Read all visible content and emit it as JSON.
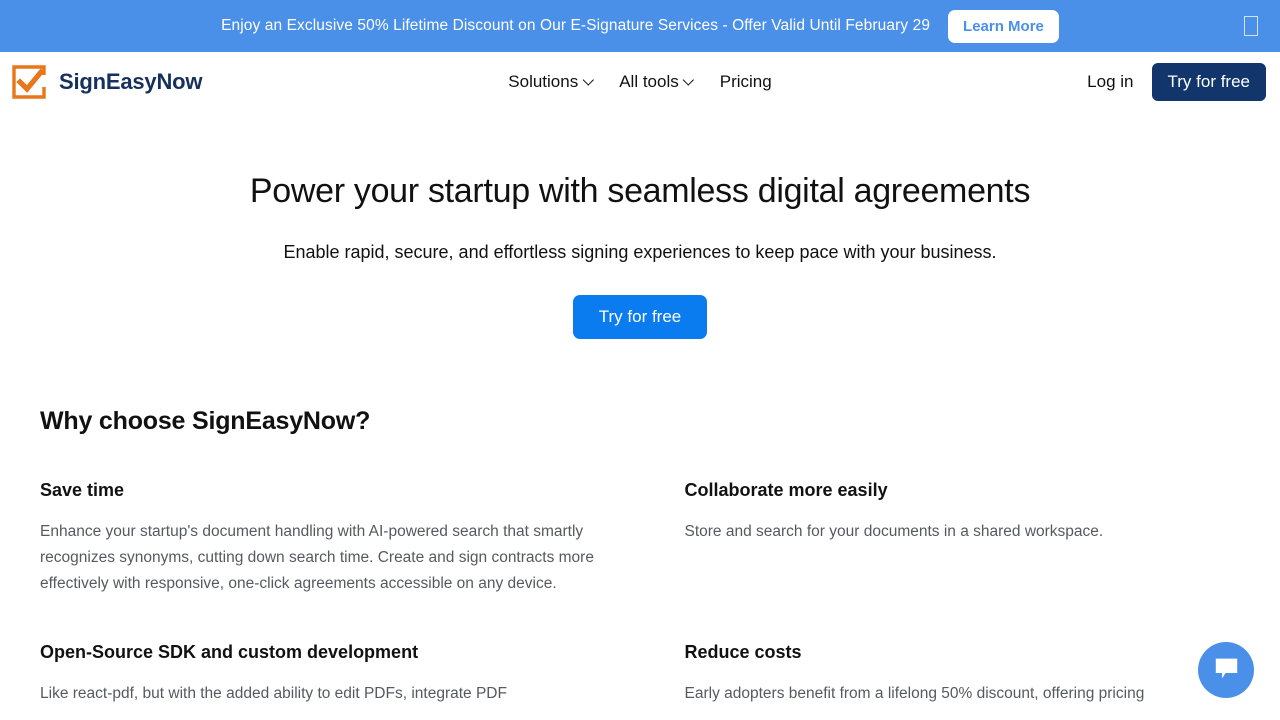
{
  "promo": {
    "text": "Enjoy an Exclusive 50% Lifetime Discount on Our E-Signature Services - Offer Valid Until February 29",
    "cta_label": "Learn More",
    "close_label": "",
    "background": "#4a90e8",
    "cta_text_color": "#4a90e8"
  },
  "header": {
    "brand_name": "SignEasyNow",
    "brand_color": "#16325c",
    "logo_color": "#e8761a",
    "nav": [
      {
        "label": "Solutions",
        "has_caret": true
      },
      {
        "label": "All tools",
        "has_caret": true
      },
      {
        "label": "Pricing",
        "has_caret": false
      }
    ],
    "login_label": "Log in",
    "trial_label": "Try for free",
    "trial_color": "#12356b"
  },
  "hero": {
    "title": "Power your startup with seamless digital agreements",
    "subtitle": "Enable rapid, secure, and effortless signing experiences to keep pace with your business.",
    "cta_label": "Try for free",
    "cta_color": "#0b7cf0"
  },
  "features": {
    "section_title": "Why choose SignEasyNow?",
    "items": [
      {
        "heading": "Save time",
        "body": "Enhance your startup's document handling with AI-powered search that smartly recognizes synonyms, cutting down search time. Create and sign contracts more effectively with responsive, one-click agreements accessible on any device."
      },
      {
        "heading": "Collaborate more easily",
        "body": "Store and search for your documents in a shared workspace."
      },
      {
        "heading": "Open-Source SDK and custom development",
        "body": "Like react-pdf, but with the added ability to edit PDFs, integrate PDF"
      },
      {
        "heading": "Reduce costs",
        "body": "Early adopters benefit from a lifelong 50% discount, offering pricing"
      }
    ]
  },
  "chat": {
    "color": "#4a90e8"
  }
}
